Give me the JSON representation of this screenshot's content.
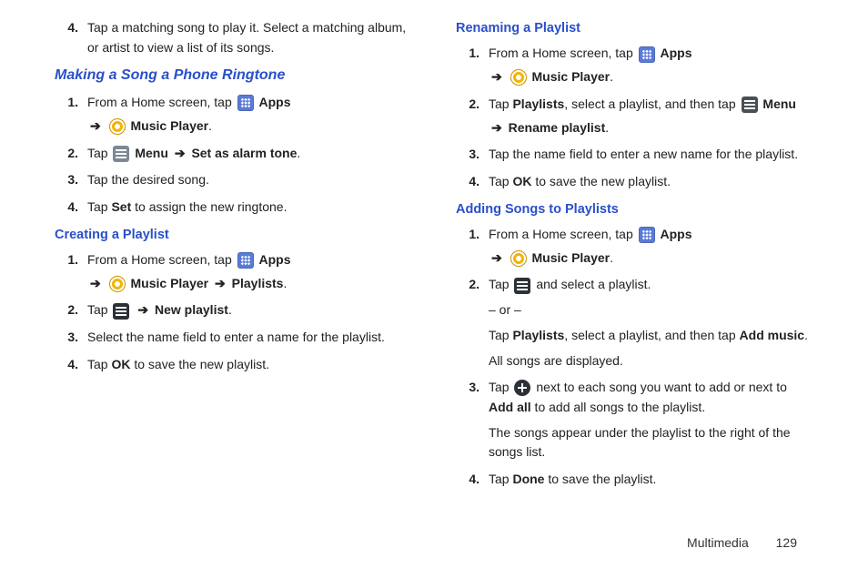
{
  "left": {
    "step4": {
      "num": "4.",
      "text": "Tap a matching song to play it. Select a matching album, or artist to view a list of its songs."
    },
    "ringtone_heading": "Making a Song a Phone Ringtone",
    "ringtone": {
      "s1_num": "1.",
      "s1_a": "From a Home screen, tap ",
      "s1_apps": "Apps",
      "s1_arrow": "➔",
      "s1_mp": "Music Player",
      "s1_dot": ".",
      "s2_num": "2.",
      "s2_a": "Tap ",
      "s2_menu": "Menu",
      "s2_arrow": "➔",
      "s2_set": "Set as alarm tone",
      "s2_dot": ".",
      "s3_num": "3.",
      "s3": "Tap the desired song.",
      "s4_num": "4.",
      "s4_a": "Tap ",
      "s4_b": "Set",
      "s4_c": " to assign the new ringtone."
    },
    "create_heading": "Creating a Playlist",
    "create": {
      "s1_num": "1.",
      "s1_a": "From a Home screen, tap ",
      "s1_apps": "Apps",
      "s1_arrow": "➔",
      "s1_mp": "Music Player",
      "s1_arrow2": "➔",
      "s1_pl": "Playlists",
      "s1_dot": ".",
      "s2_num": "2.",
      "s2_a": "Tap ",
      "s2_arrow": "➔",
      "s2_new": "New playlist",
      "s2_dot": ".",
      "s3_num": "3.",
      "s3": "Select the name field to enter a name for the playlist.",
      "s4_num": "4.",
      "s4_a": "Tap ",
      "s4_b": "OK",
      "s4_c": " to save the new playlist."
    }
  },
  "right": {
    "rename_heading": "Renaming a Playlist",
    "rename": {
      "s1_num": "1.",
      "s1_a": "From a Home screen, tap ",
      "s1_apps": "Apps",
      "s1_arrow": "➔",
      "s1_mp": "Music Player",
      "s1_dot": ".",
      "s2_num": "2.",
      "s2_a": "Tap ",
      "s2_pl": "Playlists",
      "s2_b": ", select a playlist, and then tap ",
      "s2_menu": "Menu",
      "s2_arrow": "➔",
      "s2_rp": "Rename playlist",
      "s2_dot": ".",
      "s3_num": "3.",
      "s3": "Tap the name field to enter a new name for the playlist.",
      "s4_num": "4.",
      "s4_a": "Tap ",
      "s4_b": "OK",
      "s4_c": " to save the new playlist."
    },
    "add_heading": "Adding Songs to Playlists",
    "add": {
      "s1_num": "1.",
      "s1_a": "From a Home screen, tap ",
      "s1_apps": "Apps",
      "s1_arrow": "➔",
      "s1_mp": "Music Player",
      "s1_dot": ".",
      "s2_num": "2.",
      "s2_a": "Tap ",
      "s2_b": " and select a playlist.",
      "s2_or": "– or –",
      "s2_c": "Tap ",
      "s2_pl": "Playlists",
      "s2_d": ", select a playlist, and then tap ",
      "s2_am": "Add music",
      "s2_dot": ".",
      "s2_all": "All songs are displayed.",
      "s3_num": "3.",
      "s3_a": "Tap ",
      "s3_b": " next to each song you want to add or next to ",
      "s3_addall": "Add all",
      "s3_c": " to add all songs to the playlist.",
      "s3_p2": "The songs appear under the playlist to the right of the songs list.",
      "s4_num": "4.",
      "s4_a": "Tap ",
      "s4_b": "Done",
      "s4_c": " to save the playlist."
    }
  },
  "footer": {
    "section": "Multimedia",
    "page": "129"
  }
}
